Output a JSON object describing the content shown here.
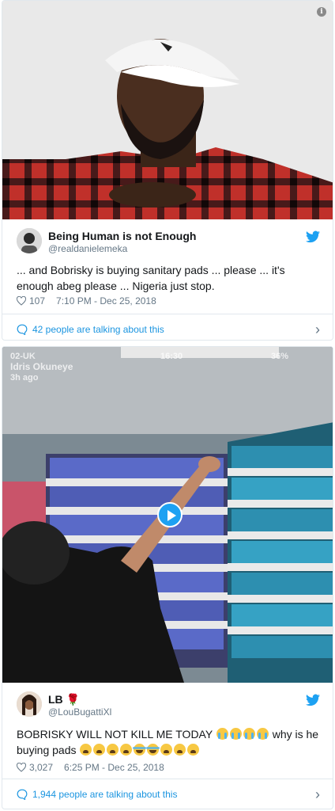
{
  "tweets": [
    {
      "author": {
        "name": "Being Human is not Enough",
        "handle": "@realdanielemeka"
      },
      "text": "... and Bobrisky is buying sanitary pads ... please ... it's enough abeg please ... Nigeria just stop.",
      "likes": "107",
      "timestamp": "7:10 PM - Dec 25, 2018",
      "talking": "42 people are talking about this"
    },
    {
      "author": {
        "name": "LB",
        "name_emoji": "🌹",
        "handle": "@LouBugattiXl"
      },
      "text_start": "BOBRISKY WILL NOT KILL ME TODAY",
      "text_mid": "why is he buying pads",
      "likes": "3,027",
      "timestamp": "6:25 PM - Dec 25, 2018",
      "talking": "1,944 people are talking about this",
      "video_overlay": {
        "carrier": "02-UK",
        "time": "16:30",
        "battery": "36%",
        "username": "Idris Okuneye",
        "ago": "3h ago"
      }
    }
  ],
  "colors": {
    "link": "#1b95e0",
    "muted": "#657786",
    "border": "#e1e8ed",
    "brand": "#1da1f2"
  },
  "icons": [
    "info-icon",
    "twitter-bird-icon",
    "heart-icon",
    "chat-bubble-icon",
    "chevron-right-icon",
    "play-icon",
    "crying-emoji",
    "weary-emoji",
    "joy-emoji",
    "rose-emoji"
  ]
}
